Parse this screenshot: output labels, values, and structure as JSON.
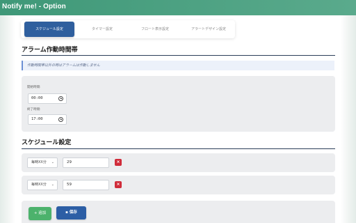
{
  "app": {
    "title": "Notify me! - Option"
  },
  "tabs": [
    {
      "label": "スケジュール設定",
      "active": true
    },
    {
      "label": "タイマー設定",
      "active": false
    },
    {
      "label": "フロート表示設定",
      "active": false
    },
    {
      "label": "アラートデザイン設定",
      "active": false
    }
  ],
  "alarm_section": {
    "title": "アラーム作動時間帯",
    "info": "作動時間帯以外の時はアラームは作動しません",
    "start_label": "開始時間:",
    "start_value": "00:00",
    "end_label": "終了時間:",
    "end_value": "17:00"
  },
  "schedule_section": {
    "title": "スケジュール設定",
    "rows": [
      {
        "type": "毎時XX分",
        "value": "29",
        "delete_label": "×"
      },
      {
        "type": "毎時XX分",
        "value": "59",
        "delete_label": "×"
      }
    ]
  },
  "actions": {
    "add_label": "+ 追加",
    "save_label": "保存"
  },
  "colors": {
    "header": "#3f9878",
    "active_tab": "#2f5f9e",
    "add_button": "#4cb26c",
    "save_button": "#2c5ea5",
    "delete_button": "#d02c3a"
  }
}
